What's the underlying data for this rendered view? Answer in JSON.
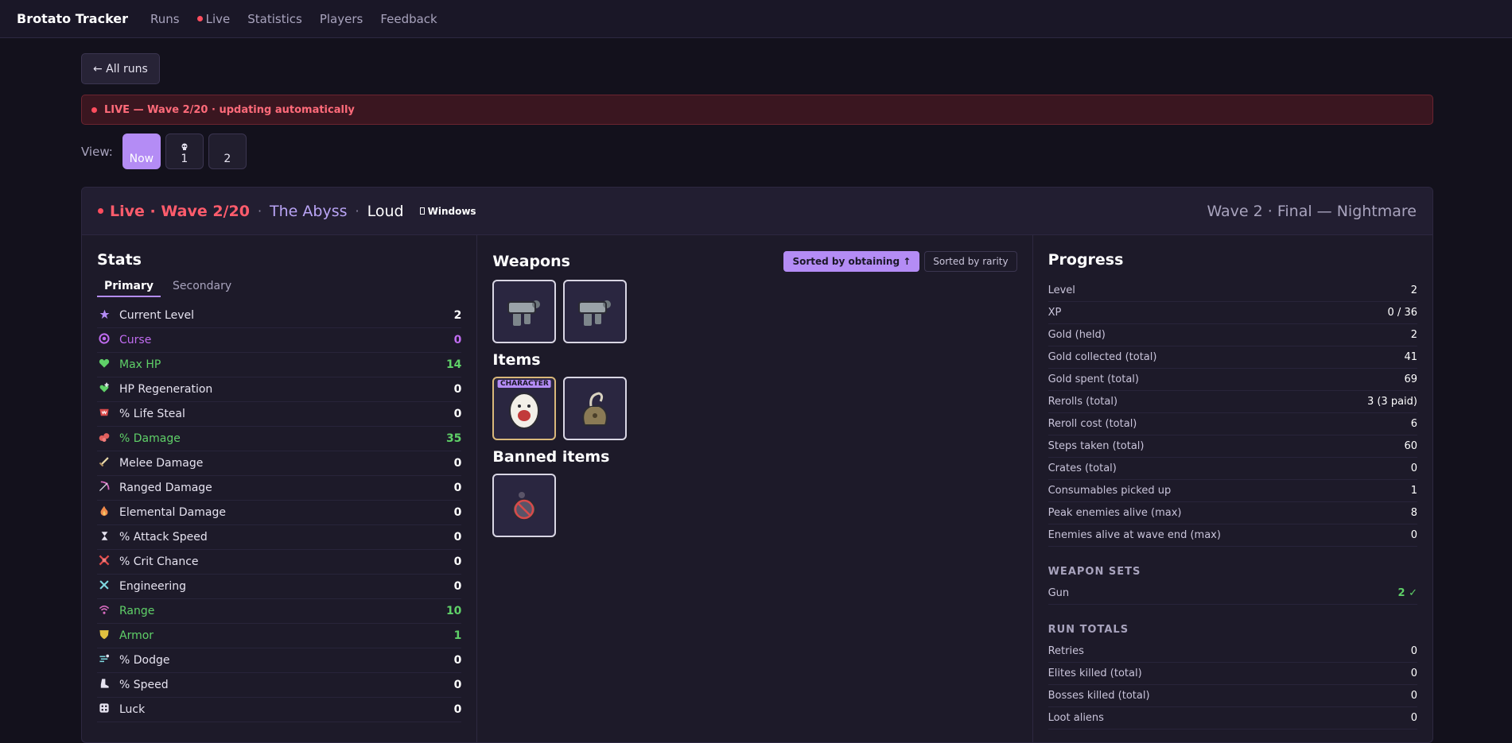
{
  "nav": {
    "brand": "Brotato Tracker",
    "links": [
      "Runs",
      "Live",
      "Statistics",
      "Players",
      "Feedback"
    ]
  },
  "back_label": "← All runs",
  "banner": "LIVE — Wave 2/20 · updating automatically",
  "view": {
    "label": "View:",
    "buttons": [
      "Now",
      "1",
      "2"
    ]
  },
  "header": {
    "live": "Live · Wave 2/20",
    "map": "The Abyss",
    "mode": "Loud",
    "platform": "Windows",
    "right": "Wave 2 · Final  —  Nightmare"
  },
  "stats": {
    "title": "Stats",
    "tabs": [
      "Primary",
      "Secondary"
    ],
    "rows": [
      {
        "name": "Current Level",
        "value": "2",
        "color": "#e6e3f0",
        "icon": "star-icon"
      },
      {
        "name": "Curse",
        "value": "0",
        "color": "#c06cf0",
        "icon": "curse-icon"
      },
      {
        "name": "Max HP",
        "value": "14",
        "color": "#5fd068",
        "icon": "heart-icon"
      },
      {
        "name": "HP Regeneration",
        "value": "0",
        "color": "#e6e3f0",
        "icon": "regen-icon"
      },
      {
        "name": "% Life Steal",
        "value": "0",
        "color": "#e6e3f0",
        "icon": "lifesteal-icon"
      },
      {
        "name": "% Damage",
        "value": "35",
        "color": "#5fd068",
        "icon": "damage-icon"
      },
      {
        "name": "Melee Damage",
        "value": "0",
        "color": "#e6e3f0",
        "icon": "sword-icon"
      },
      {
        "name": "Ranged Damage",
        "value": "0",
        "color": "#e6e3f0",
        "icon": "bow-icon"
      },
      {
        "name": "Elemental Damage",
        "value": "0",
        "color": "#e6e3f0",
        "icon": "fire-icon"
      },
      {
        "name": "% Attack Speed",
        "value": "0",
        "color": "#e6e3f0",
        "icon": "hourglass-icon"
      },
      {
        "name": "% Crit Chance",
        "value": "0",
        "color": "#e6e3f0",
        "icon": "crit-icon"
      },
      {
        "name": "Engineering",
        "value": "0",
        "color": "#e6e3f0",
        "icon": "wrench-icon"
      },
      {
        "name": "Range",
        "value": "10",
        "color": "#5fd068",
        "icon": "range-icon"
      },
      {
        "name": "Armor",
        "value": "1",
        "color": "#5fd068",
        "icon": "shield-icon"
      },
      {
        "name": "% Dodge",
        "value": "0",
        "color": "#e6e3f0",
        "icon": "dodge-icon"
      },
      {
        "name": "% Speed",
        "value": "0",
        "color": "#e6e3f0",
        "icon": "boot-icon"
      },
      {
        "name": "Luck",
        "value": "0",
        "color": "#e6e3f0",
        "icon": "dice-icon"
      }
    ]
  },
  "weapons": {
    "title": "Weapons",
    "sort_obtaining": "Sorted by obtaining ↑",
    "sort_rarity": "Sorted by rarity",
    "icons": [
      "pistol-icon",
      "pistol-icon"
    ]
  },
  "items": {
    "title": "Items",
    "character_badge": "CHARACTER",
    "icons": [
      "egg-character-icon",
      "sack-item-icon"
    ]
  },
  "banned": {
    "title": "Banned items",
    "icons": [
      "banned-item-icon"
    ]
  },
  "progress": {
    "title": "Progress",
    "rows": [
      {
        "label": "Level",
        "value": "2"
      },
      {
        "label": "XP",
        "value": "0 / 36"
      },
      {
        "label": "Gold (held)",
        "value": "2"
      },
      {
        "label": "Gold collected (total)",
        "value": "41"
      },
      {
        "label": "Gold spent (total)",
        "value": "69"
      },
      {
        "label": "Rerolls (total)",
        "value": "3 (3 paid)"
      },
      {
        "label": "Reroll cost (total)",
        "value": "6"
      },
      {
        "label": "Steps taken (total)",
        "value": "60"
      },
      {
        "label": "Crates (total)",
        "value": "0"
      },
      {
        "label": "Consumables picked up",
        "value": "1"
      },
      {
        "label": "Peak enemies alive (max)",
        "value": "8"
      },
      {
        "label": "Enemies alive at wave end (max)",
        "value": "0"
      }
    ],
    "weapon_sets_title": "WEAPON SETS",
    "weapon_sets": [
      {
        "label": "Gun",
        "value": "2 ✓"
      }
    ],
    "run_totals_title": "RUN TOTALS",
    "run_totals": [
      {
        "label": "Retries",
        "value": "0"
      },
      {
        "label": "Elites killed (total)",
        "value": "0"
      },
      {
        "label": "Bosses killed (total)",
        "value": "0"
      },
      {
        "label": "Loot aliens",
        "value": "0"
      }
    ]
  },
  "colors": {
    "accent": "#b48cf5",
    "live": "#ff5c6c",
    "positive": "#5fd068"
  }
}
